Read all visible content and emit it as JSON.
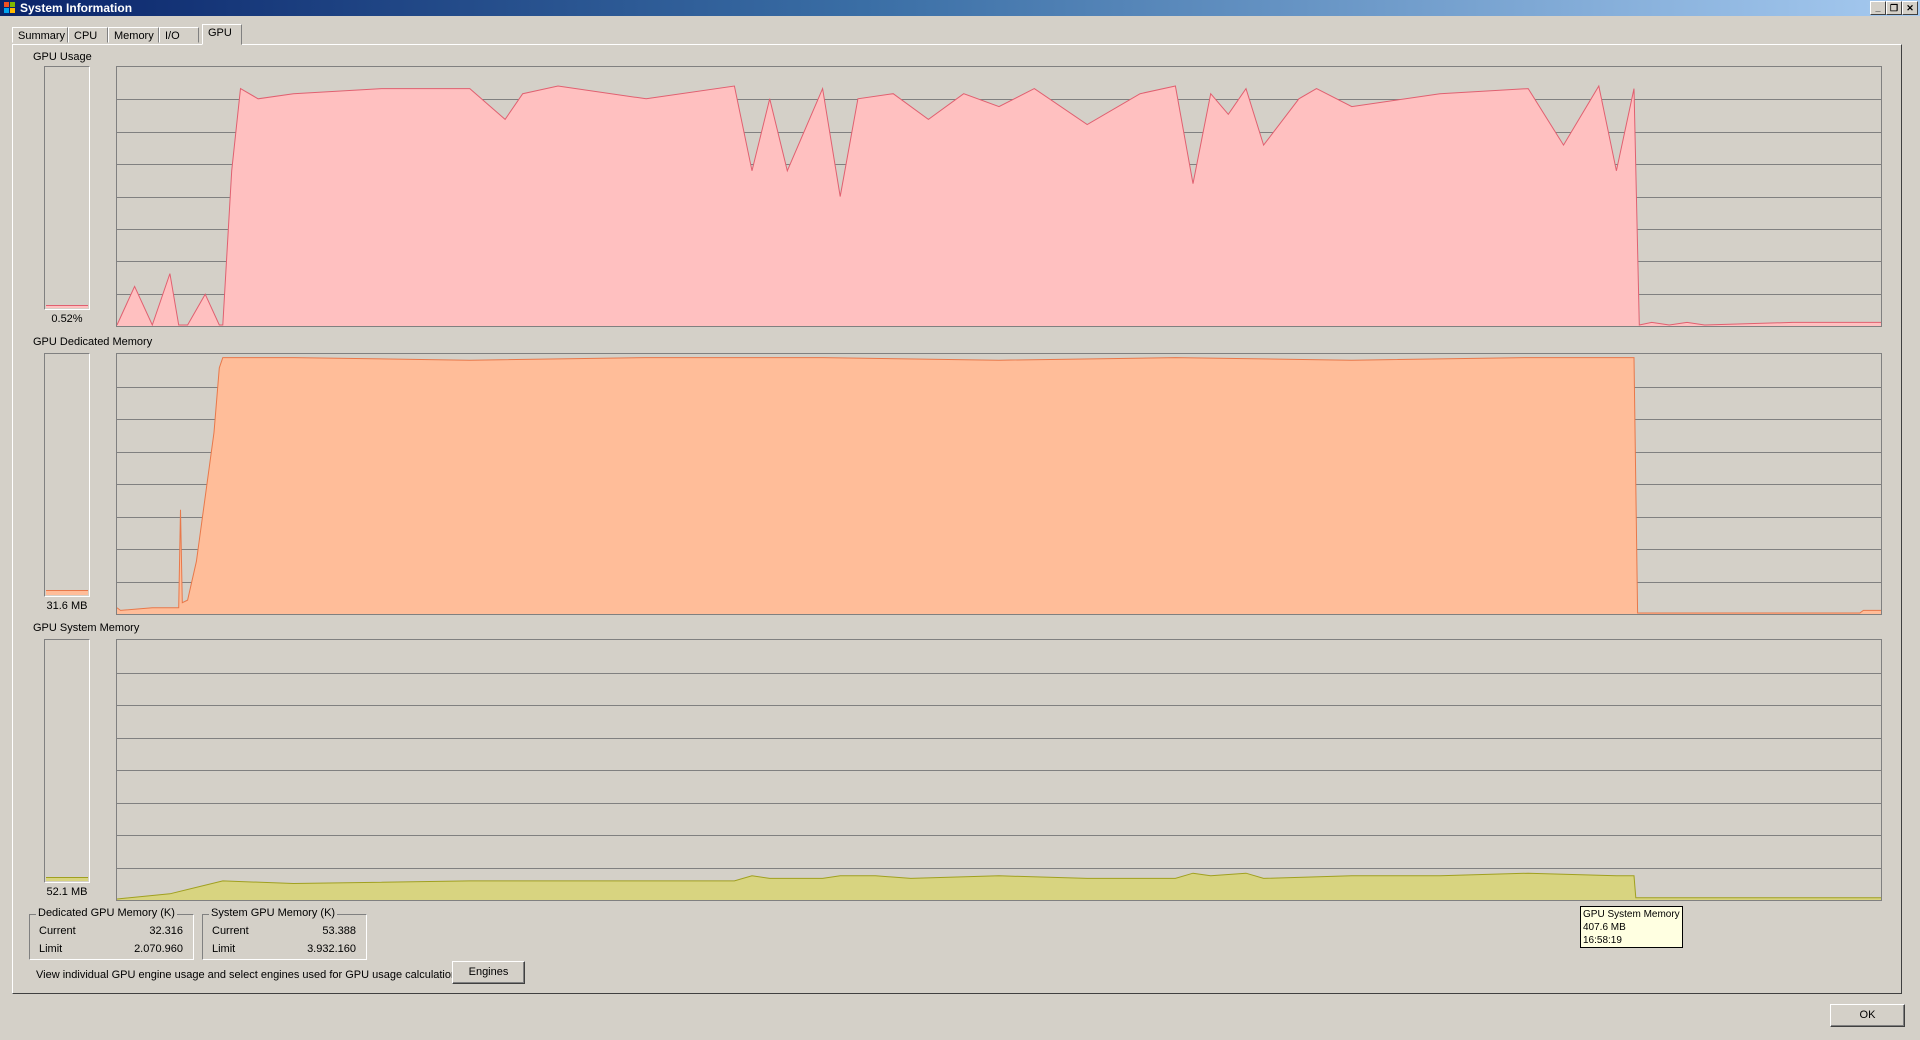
{
  "window": {
    "title": "System Information",
    "controls": {
      "minimize": "_",
      "restore": "❐",
      "close": "✕"
    }
  },
  "tabs": [
    {
      "label": "Summary"
    },
    {
      "label": "CPU"
    },
    {
      "label": "Memory"
    },
    {
      "label": "I/O"
    },
    {
      "label": "GPU",
      "active": true
    }
  ],
  "sections": {
    "gpu_usage": {
      "label": "GPU Usage",
      "value": "0.52%",
      "level": 0.0052,
      "fill": "#ffc0c0",
      "stroke": "#e06070"
    },
    "dedicated": {
      "label": "GPU Dedicated Memory",
      "value": "31.6 MB",
      "level": 0.015,
      "fill": "#ffbd99",
      "stroke": "#e8784a"
    },
    "system": {
      "label": "GPU System Memory",
      "value": "52.1 MB",
      "level": 0.013,
      "fill": "#d8d480",
      "stroke": "#a0a020"
    }
  },
  "dedicated_box": {
    "title": "Dedicated GPU Memory (K)",
    "current_label": "Current",
    "current_value": "32.316",
    "limit_label": "Limit",
    "limit_value": "2.070.960"
  },
  "system_box": {
    "title": "System GPU Memory (K)",
    "current_label": "Current",
    "current_value": "53.388",
    "limit_label": "Limit",
    "limit_value": "3.932.160"
  },
  "engines": {
    "text": "View individual GPU engine usage and select engines used for GPU usage calculations:",
    "button_label": "Engines"
  },
  "tooltip": {
    "title": "GPU System Memory",
    "value": "407.6 MB",
    "time": "16:58:19"
  },
  "ok_label": "OK",
  "chart_data": [
    {
      "type": "area",
      "title": "GPU Usage",
      "ylim": [
        0,
        100
      ],
      "x_range": [
        0,
        100
      ],
      "grid": true,
      "series": [
        {
          "x": [
            0,
            1,
            2,
            3,
            3.5,
            4,
            5,
            5.8,
            6,
            6.5,
            7,
            8,
            10,
            15,
            20,
            22,
            23,
            25,
            30,
            35,
            36,
            37,
            38,
            40,
            41,
            42,
            44,
            46,
            48,
            50,
            52,
            55,
            58,
            60,
            61,
            62,
            63,
            64,
            65,
            67,
            68,
            70,
            75,
            80,
            82,
            84,
            85,
            86,
            86.3,
            87,
            88,
            89,
            90,
            95,
            100
          ],
          "y": [
            0,
            15,
            0,
            20,
            0,
            0,
            12,
            0,
            0,
            60,
            92,
            88,
            90,
            92,
            92,
            80,
            90,
            93,
            88,
            93,
            60,
            88,
            60,
            92,
            50,
            88,
            90,
            80,
            90,
            85,
            92,
            78,
            90,
            93,
            55,
            90,
            82,
            92,
            70,
            88,
            92,
            85,
            90,
            92,
            70,
            93,
            60,
            92,
            0,
            1,
            0,
            1,
            0,
            1,
            1
          ]
        }
      ]
    },
    {
      "type": "area",
      "title": "GPU Dedicated Memory",
      "ylim": [
        0,
        100
      ],
      "x_range": [
        0,
        100
      ],
      "grid": true,
      "series": [
        {
          "x": [
            0,
            0.2,
            2,
            3.5,
            3.6,
            3.7,
            4,
            4.5,
            5,
            5.5,
            5.8,
            6,
            10,
            20,
            30,
            40,
            50,
            60,
            70,
            80,
            85,
            86,
            86.2,
            98.8,
            99,
            100
          ],
          "y": [
            2,
            1,
            2,
            2,
            40,
            4,
            5,
            20,
            45,
            70,
            95,
            99,
            99,
            98,
            99,
            99,
            98,
            99,
            98,
            99,
            99,
            99,
            0,
            0,
            1,
            1
          ]
        }
      ]
    },
    {
      "type": "area",
      "title": "GPU System Memory",
      "ylim": [
        0,
        100
      ],
      "x_range": [
        0,
        100
      ],
      "grid": true,
      "series": [
        {
          "x": [
            0,
            3,
            6,
            10,
            20,
            30,
            35,
            36,
            37,
            40,
            41,
            43,
            45,
            50,
            55,
            60,
            61,
            62,
            64,
            65,
            70,
            75,
            80,
            85,
            86,
            86.1,
            100
          ],
          "y": [
            0,
            2,
            7,
            6,
            7,
            7,
            7,
            9,
            8,
            8,
            9,
            9,
            8,
            9,
            8,
            8,
            10,
            9,
            10,
            8,
            9,
            9,
            10,
            9,
            9,
            0.5,
            0.5
          ]
        }
      ]
    }
  ]
}
